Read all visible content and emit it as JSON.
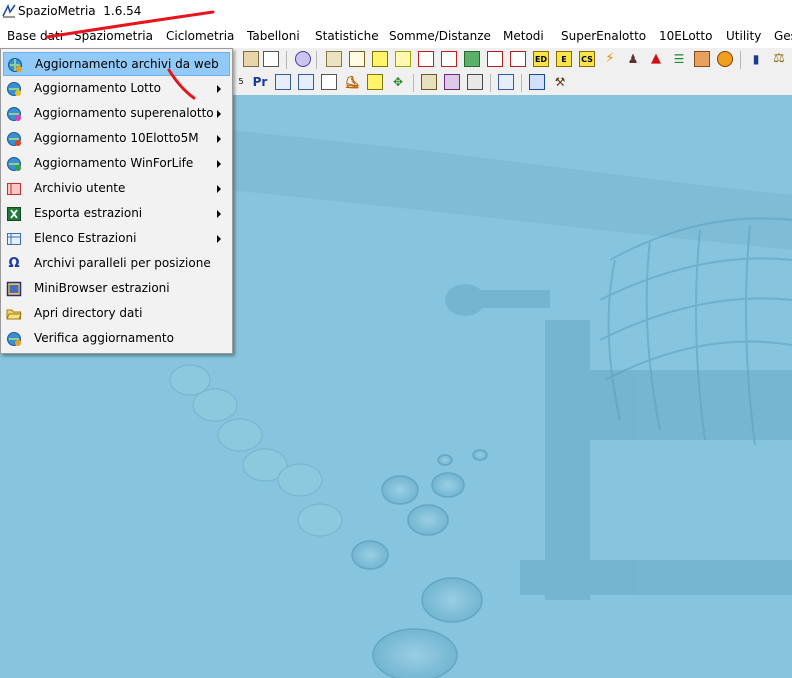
{
  "window": {
    "title": "SpazioMetria",
    "version": "1.6.54"
  },
  "menubar": {
    "items": [
      "Base dati",
      "Spaziometria",
      "Ciclometria",
      "Tabelloni",
      "Statistiche",
      "Somme/Distanze",
      "Metodi",
      "SuperEnalotto",
      "10ELotto",
      "Utility",
      "Ges"
    ]
  },
  "toolbar": {
    "row1_text": [
      "Pr",
      "ED",
      "E",
      "CS"
    ],
    "row1_leading": "5"
  },
  "dropdown": {
    "items": [
      {
        "label": "Aggiornamento archivi da web",
        "icon": "globe-update-icon",
        "submenu": false,
        "highlighted": true
      },
      {
        "label": "Aggiornamento Lotto",
        "icon": "globe-lotto-icon",
        "submenu": true
      },
      {
        "label": "Aggiornamento superenalotto",
        "icon": "globe-superenalotto-icon",
        "submenu": true
      },
      {
        "label": "Aggiornamento 10Elotto5M",
        "icon": "globe-10elotto-icon",
        "submenu": true
      },
      {
        "label": "Aggiornamento WinForLife",
        "icon": "globe-winforlife-icon",
        "submenu": true
      },
      {
        "label": "Archivio utente",
        "icon": "user-archive-icon",
        "submenu": true
      },
      {
        "label": "Esporta estrazioni",
        "icon": "excel-export-icon",
        "submenu": true
      },
      {
        "label": "Elenco Estrazioni",
        "icon": "table-list-icon",
        "submenu": true
      },
      {
        "label": "Archivi paralleli per posizione",
        "icon": "omega-icon",
        "submenu": false
      },
      {
        "label": "MiniBrowser estrazioni",
        "icon": "minibrowser-icon",
        "submenu": false
      },
      {
        "label": "Apri directory dati",
        "icon": "folder-open-icon",
        "submenu": false
      },
      {
        "label": "Verifica aggiornamento",
        "icon": "globe-check-icon",
        "submenu": false
      }
    ]
  },
  "colors": {
    "highlight": "#91c9f7",
    "workspace": "#80c1db",
    "annotation": "#e8141c"
  }
}
